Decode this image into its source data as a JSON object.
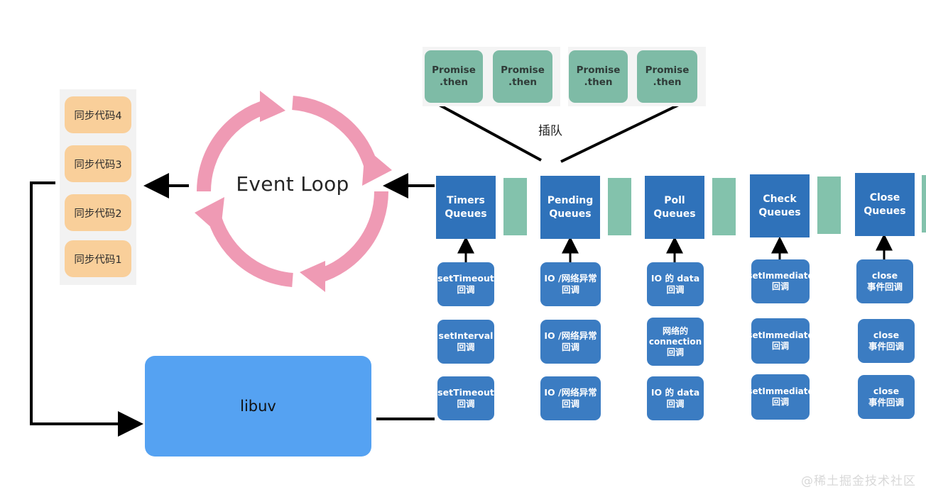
{
  "diagram": {
    "center_label": "Event Loop",
    "libuv_label": "libuv",
    "queue_insert_label": "插队",
    "watermark": "@稀土掘金技术社区"
  },
  "call_stack": {
    "items": [
      {
        "label": "同步代码4"
      },
      {
        "label": "同步代码3"
      },
      {
        "label": "同步代码2"
      },
      {
        "label": "同步代码1"
      }
    ]
  },
  "microtasks": {
    "items": [
      {
        "line1": "Promise",
        "line2": ".then"
      },
      {
        "line1": "Promise",
        "line2": ".then"
      },
      {
        "line1": "Promise",
        "line2": ".then"
      },
      {
        "line1": "Promise",
        "line2": ".then"
      }
    ]
  },
  "phases": [
    {
      "title_line1": "Timers",
      "title_line2": "Queues",
      "callbacks": [
        {
          "line1": "setTimeout",
          "line2": "回调"
        },
        {
          "line1": "setInterval",
          "line2": "回调"
        },
        {
          "line1": "setTimeout",
          "line2": "回调"
        }
      ]
    },
    {
      "title_line1": "Pending",
      "title_line2": "Queues",
      "callbacks": [
        {
          "line1": "IO /网络异常",
          "line2": "回调"
        },
        {
          "line1": "IO /网络异常",
          "line2": "回调"
        },
        {
          "line1": "IO /网络异常",
          "line2": "回调"
        }
      ]
    },
    {
      "title_line1": "Poll",
      "title_line2": "Queues",
      "callbacks": [
        {
          "line1": "IO 的 data",
          "line2": "回调"
        },
        {
          "line1": "网络的 connection",
          "line2": "回调"
        },
        {
          "line1": "IO 的 data",
          "line2": "回调"
        }
      ]
    },
    {
      "title_line1": "Check",
      "title_line2": "Queues",
      "callbacks": [
        {
          "line1": "setImmediate",
          "line2": "回调"
        },
        {
          "line1": "setImmediate",
          "line2": "回调"
        },
        {
          "line1": "setImmediate",
          "line2": "回调"
        }
      ]
    },
    {
      "title_line1": "Close",
      "title_line2": "Queues",
      "callbacks": [
        {
          "line1": "close",
          "line2": "事件回调"
        },
        {
          "line1": "close",
          "line2": "事件回调"
        },
        {
          "line1": "close",
          "line2": "事件回调"
        }
      ]
    }
  ],
  "colors": {
    "stack_box": "#f9cf9a",
    "loop_arrow": "#ef9ab4",
    "libuv": "#55a2f2",
    "promise": "#7ebba6",
    "queue_header": "#2f72ba",
    "queue_bar": "#83c2ac",
    "callback": "#3b7cc2",
    "connector": "#000000",
    "watermark": "#d8d8d8"
  }
}
